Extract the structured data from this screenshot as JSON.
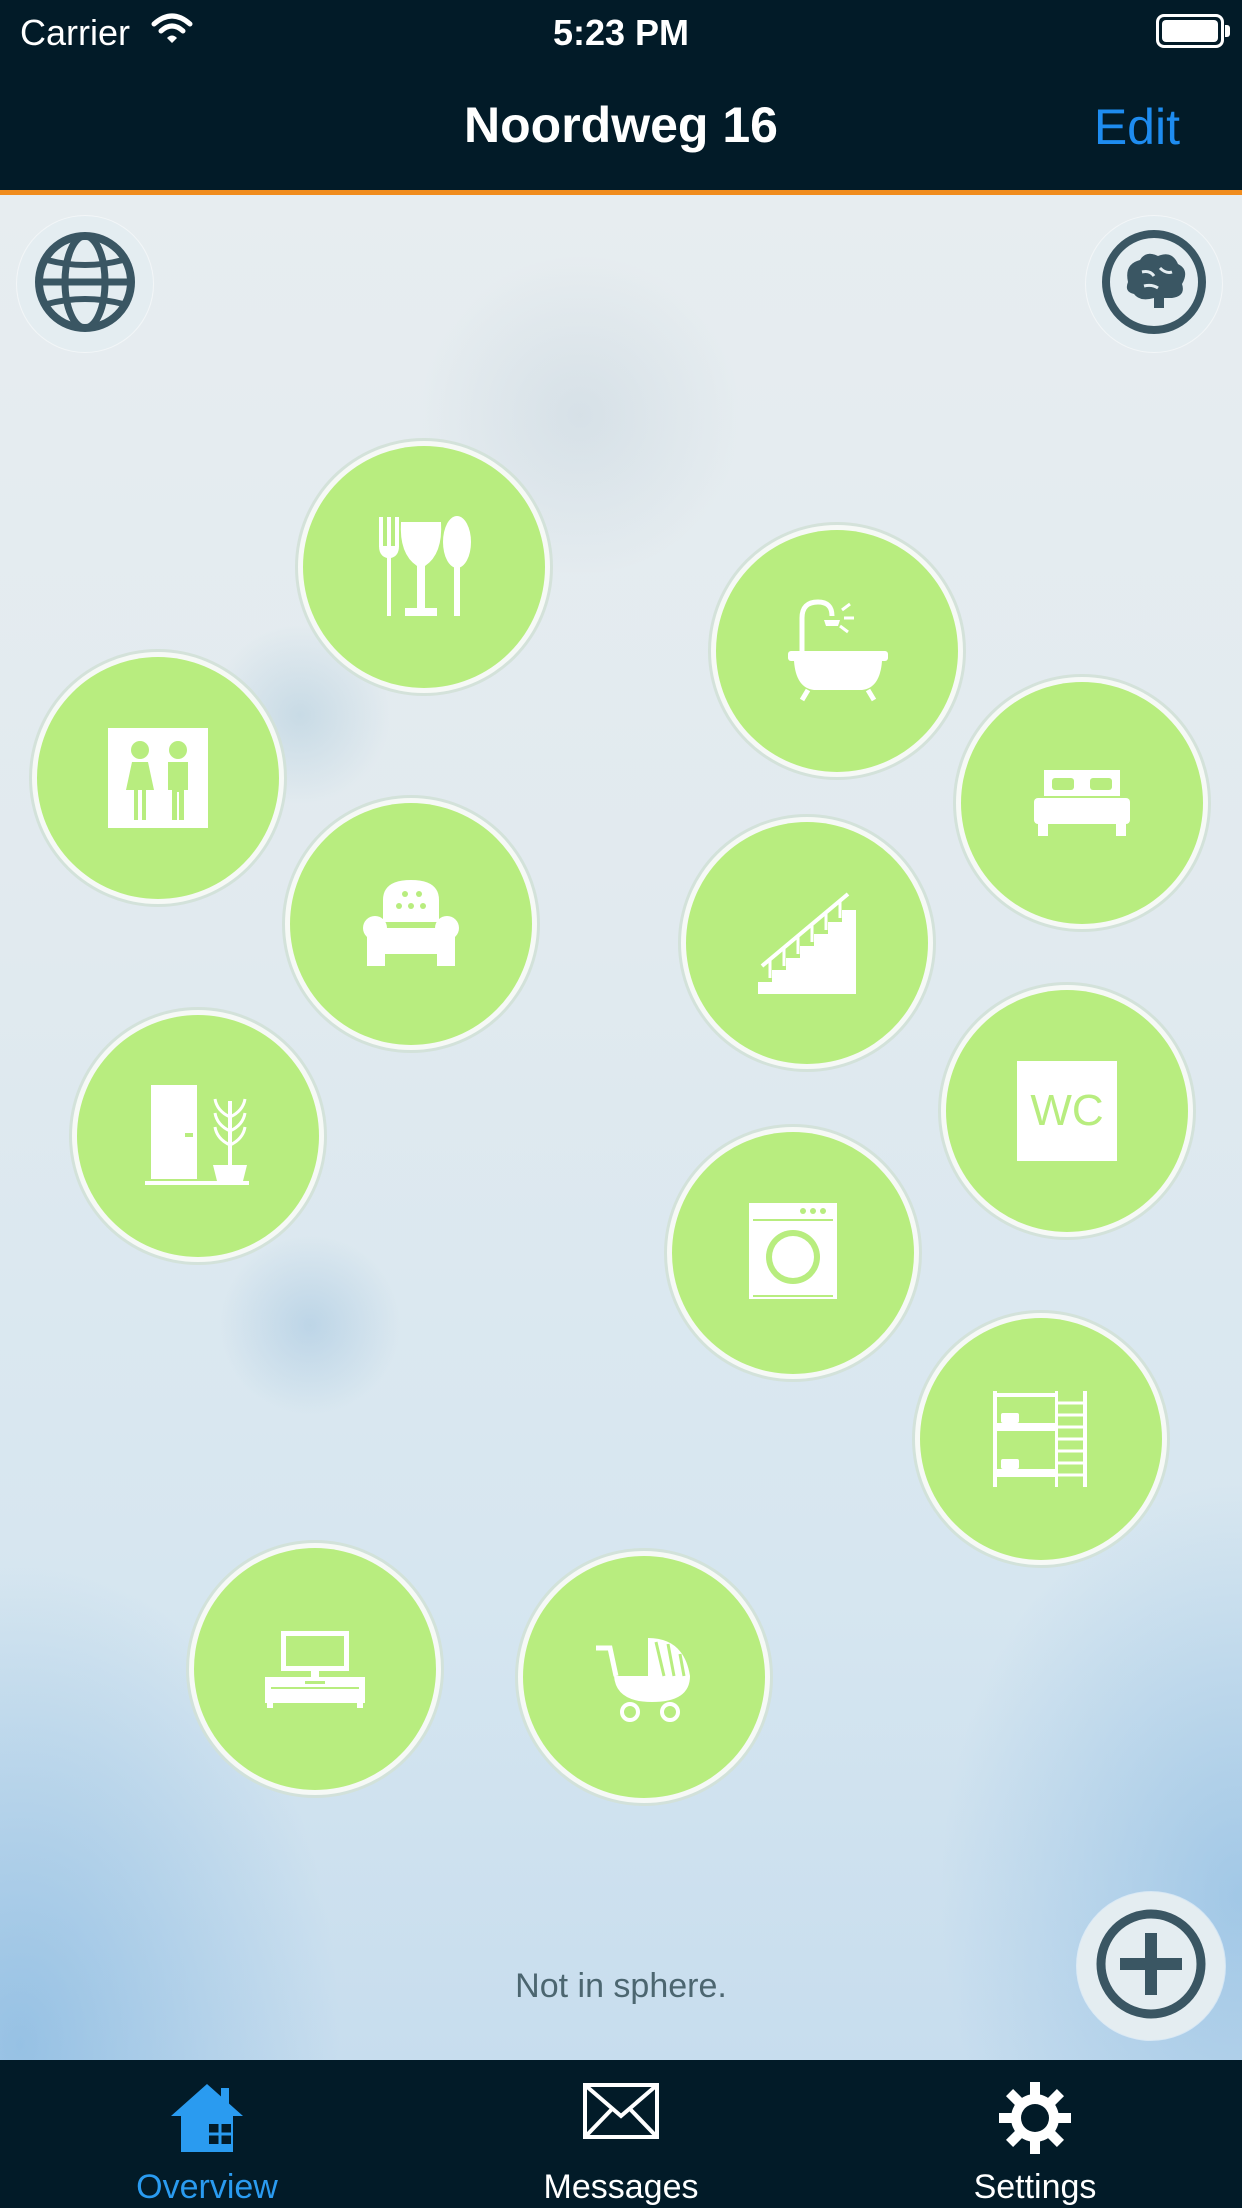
{
  "status_bar": {
    "carrier": "Carrier",
    "time": "5:23 PM"
  },
  "nav": {
    "title": "Noordweg 16",
    "edit_label": "Edit"
  },
  "rooms": [
    {
      "name": "dining-room",
      "icon": "dining-icon"
    },
    {
      "name": "bathroom",
      "icon": "bathtub-icon"
    },
    {
      "name": "restroom",
      "icon": "restroom-people-icon"
    },
    {
      "name": "bedroom",
      "icon": "bed-icon"
    },
    {
      "name": "living-room",
      "icon": "armchair-icon"
    },
    {
      "name": "stairs",
      "icon": "stairs-icon"
    },
    {
      "name": "hallway",
      "icon": "door-plant-icon"
    },
    {
      "name": "toilet",
      "icon": "wc-icon",
      "text": "WC"
    },
    {
      "name": "laundry",
      "icon": "washing-machine-icon"
    },
    {
      "name": "kids-room",
      "icon": "bunk-bed-icon"
    },
    {
      "name": "tv-room",
      "icon": "tv-icon"
    },
    {
      "name": "nursery",
      "icon": "stroller-icon"
    }
  ],
  "status_text": "Not in sphere.",
  "tabs": [
    {
      "label": "Overview",
      "icon": "house-icon",
      "active": true
    },
    {
      "label": "Messages",
      "icon": "envelope-icon",
      "active": false
    },
    {
      "label": "Settings",
      "icon": "gear-icon",
      "active": false
    }
  ],
  "colors": {
    "room_fill": "#b8ed7f",
    "nav_background": "#021b28",
    "accent_orange": "#f08c1e",
    "accent_blue": "#1e8cf0"
  }
}
